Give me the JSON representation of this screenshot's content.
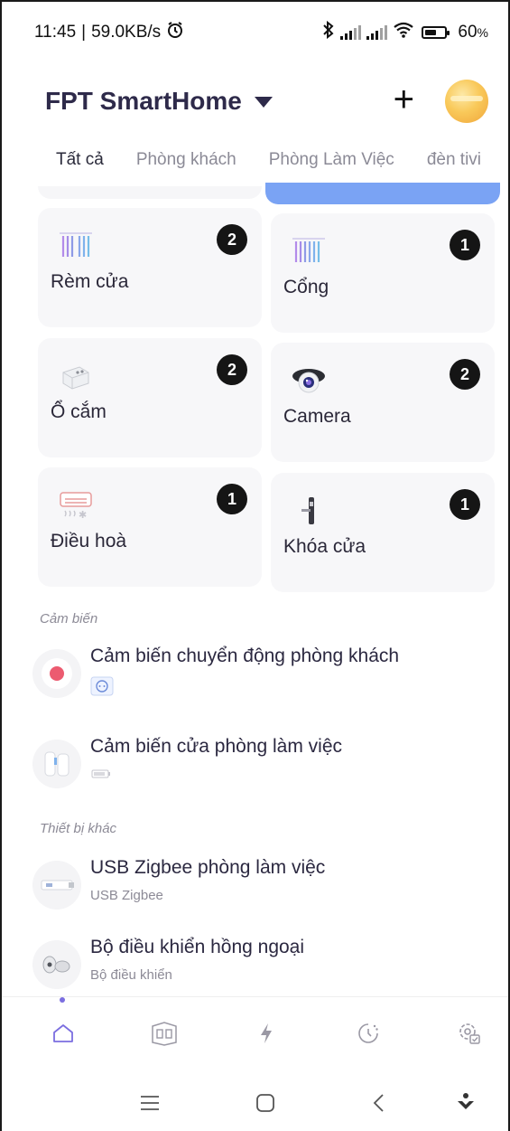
{
  "status_bar": {
    "time": "11:45",
    "speed": "59.0KB/s",
    "battery": "60",
    "battery_unit": "%",
    "battery_level": 0.6
  },
  "header": {
    "home_name": "FPT SmartHome",
    "add_icon": "plus-icon",
    "avatar_icon": "avatar"
  },
  "tabs": [
    {
      "label": "Tất cả",
      "active": true
    },
    {
      "label": "Phòng khách",
      "active": false
    },
    {
      "label": "Phòng Làm Việc",
      "active": false
    },
    {
      "label": "đèn tivi",
      "active": false
    }
  ],
  "device_groups": [
    {
      "label": "Rèm cửa",
      "count": "2",
      "icon": "curtain-icon"
    },
    {
      "label": "Cổng",
      "count": "1",
      "icon": "gate-icon"
    },
    {
      "label": "Ổ cắm",
      "count": "2",
      "icon": "socket-icon"
    },
    {
      "label": "Camera",
      "count": "2",
      "icon": "camera-icon"
    },
    {
      "label": "Điều hoà",
      "count": "1",
      "icon": "air-conditioner-icon"
    },
    {
      "label": "Khóa cửa",
      "count": "1",
      "icon": "door-lock-icon"
    }
  ],
  "sensors": {
    "title": "Cảm biến",
    "items": [
      {
        "name": "Cảm biến chuyển động phòng khách",
        "icon": "motion-sensor-icon",
        "status_icon": "motion-status-icon"
      },
      {
        "name": "Cảm biến cửa phòng làm việc",
        "icon": "door-sensor-icon",
        "status_icon": "battery-status-icon"
      }
    ]
  },
  "other_devices": {
    "title": "Thiết bị khác",
    "items": [
      {
        "name": "USB Zigbee phòng làm việc",
        "subtitle": "USB Zigbee",
        "icon": "usb-zigbee-icon"
      },
      {
        "name": "Bộ điều khiển hồng ngoại",
        "subtitle": "Bộ điều khiển",
        "icon": "ir-remote-icon"
      }
    ]
  },
  "bottom_nav": [
    {
      "icon": "home-icon",
      "active": true
    },
    {
      "icon": "rooms-icon",
      "active": false
    },
    {
      "icon": "lightning-icon",
      "active": false
    },
    {
      "icon": "clock-icon",
      "active": false
    },
    {
      "icon": "settings-icon",
      "active": false
    }
  ],
  "colors": {
    "accent": "#7b6ee0",
    "badge": "#151515",
    "card_bg": "#f7f7f9",
    "highlight_blue": "#7aa3f4"
  }
}
